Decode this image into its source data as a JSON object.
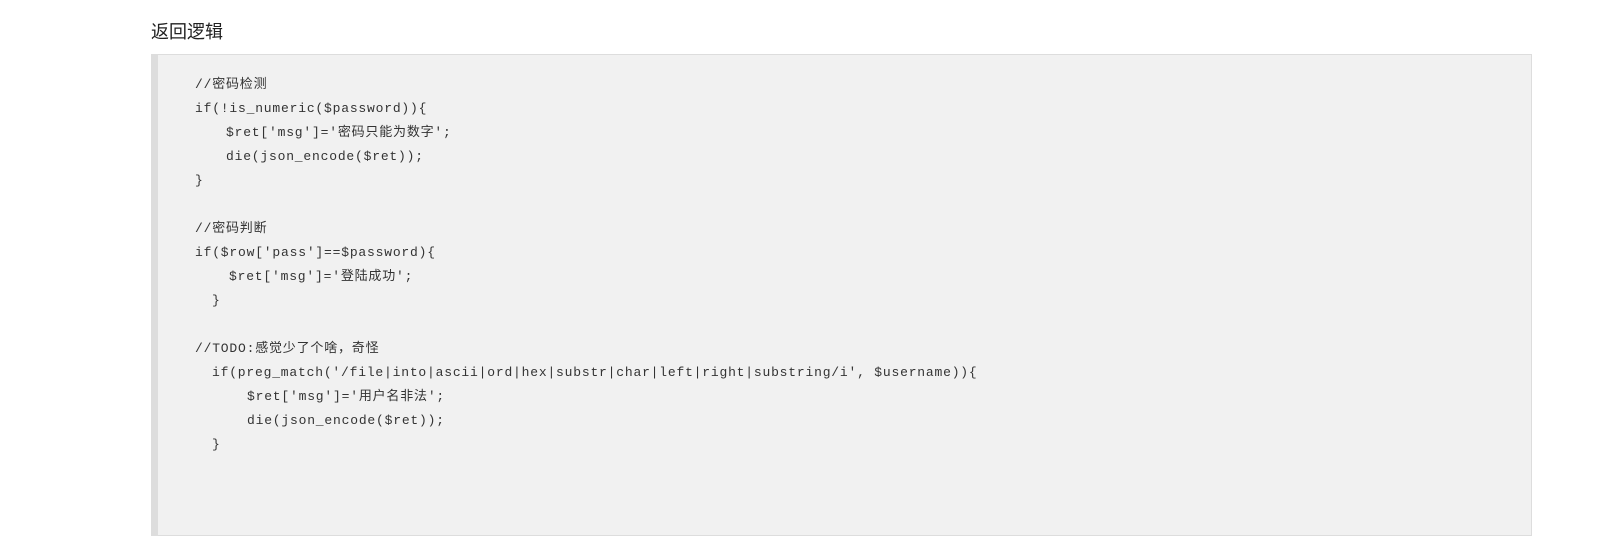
{
  "section_title": "返回逻辑",
  "code": {
    "lines": [
      "//密码检测",
      "if(!is_numeric($password)){",
      "$ret['msg']='密码只能为数字';",
      "die(json_encode($ret));",
      "}",
      "",
      "//密码判断",
      "if($row['pass']==$password){",
      "$ret['msg']='登陆成功';",
      "}",
      "",
      "//TODO:感觉少了个啥，奇怪",
      "if(preg_match('/file|into|ascii|ord|hex|substr|char|left|right|substring/i', $username)){",
      "$ret['msg']='用户名非法';",
      "die(json_encode($ret));",
      "}"
    ]
  }
}
